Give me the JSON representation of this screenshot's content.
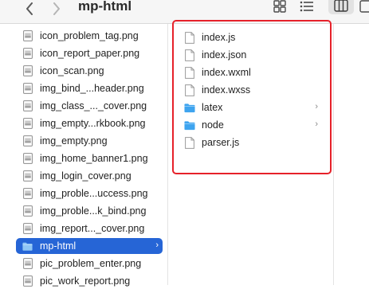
{
  "window": {
    "title": "mp-html"
  },
  "toolbar": {
    "back_icon": "chevron-left-icon",
    "forward_icon": "chevron-right-icon",
    "view_icons": [
      "icon-grid-view-icon",
      "list-view-icon",
      "column-view-icon"
    ]
  },
  "left_column": {
    "items": [
      {
        "label": "icon_problem_tag.png",
        "icon": "image-file-icon",
        "selected": false
      },
      {
        "label": "icon_report_paper.png",
        "icon": "image-file-icon",
        "selected": false
      },
      {
        "label": "icon_scan.png",
        "icon": "image-file-icon",
        "selected": false
      },
      {
        "label": "img_bind_...header.png",
        "icon": "image-file-icon",
        "selected": false
      },
      {
        "label": "img_class_..._cover.png",
        "icon": "image-file-icon",
        "selected": false
      },
      {
        "label": "img_empty...rkbook.png",
        "icon": "image-file-icon",
        "selected": false
      },
      {
        "label": "img_empty.png",
        "icon": "image-file-icon",
        "selected": false
      },
      {
        "label": "img_home_banner1.png",
        "icon": "image-file-icon",
        "selected": false
      },
      {
        "label": "img_login_cover.png",
        "icon": "image-file-icon",
        "selected": false
      },
      {
        "label": "img_proble...uccess.png",
        "icon": "image-file-icon",
        "selected": false
      },
      {
        "label": "img_proble...k_bind.png",
        "icon": "image-file-icon",
        "selected": false
      },
      {
        "label": "img_report..._cover.png",
        "icon": "image-file-icon",
        "selected": false
      },
      {
        "label": "mp-html",
        "icon": "folder-icon",
        "selected": true
      },
      {
        "label": "pic_problem_enter.png",
        "icon": "image-file-icon",
        "selected": false
      },
      {
        "label": "pic_work_report.png",
        "icon": "image-file-icon",
        "selected": false
      }
    ]
  },
  "middle_column": {
    "items": [
      {
        "label": "index.js",
        "icon": "document-icon",
        "has_children": false
      },
      {
        "label": "index.json",
        "icon": "document-icon",
        "has_children": false
      },
      {
        "label": "index.wxml",
        "icon": "document-icon",
        "has_children": false
      },
      {
        "label": "index.wxss",
        "icon": "document-icon",
        "has_children": false
      },
      {
        "label": "latex",
        "icon": "folder-icon",
        "has_children": true
      },
      {
        "label": "node",
        "icon": "folder-icon",
        "has_children": true
      },
      {
        "label": "parser.js",
        "icon": "document-icon",
        "has_children": false
      }
    ]
  },
  "colors": {
    "selection": "#2665d6",
    "annotation_box": "#e6212a",
    "folder": "#3ea4ef"
  }
}
